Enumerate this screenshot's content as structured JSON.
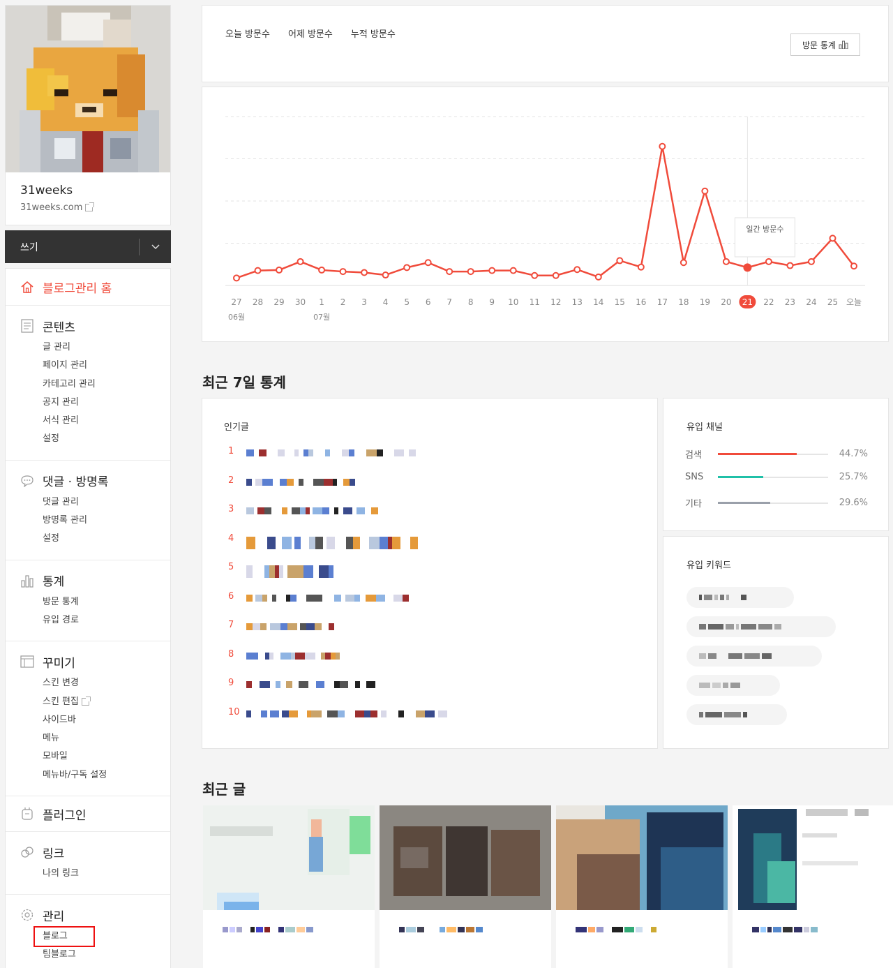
{
  "sidebar": {
    "blog_name": "31weeks",
    "blog_url": "31weeks.com",
    "write_label": "쓰기",
    "home_label": "블로그관리 홈",
    "groups": [
      {
        "title": "콘텐츠",
        "items": [
          "글 관리",
          "페이지 관리",
          "카테고리 관리",
          "공지 관리",
          "서식 관리",
          "설정"
        ]
      },
      {
        "title": "댓글 · 방명록",
        "items": [
          "댓글 관리",
          "방명록 관리",
          "설정"
        ]
      },
      {
        "title": "통계",
        "items": [
          "방문 통계",
          "유입 경로"
        ]
      },
      {
        "title": "꾸미기",
        "items": [
          "스킨 변경",
          "스킨 편집",
          "사이드바",
          "메뉴",
          "모바일",
          "메뉴바/구독 설정"
        ]
      },
      {
        "title": "플러그인",
        "items": []
      },
      {
        "title": "링크",
        "items": [
          "나의 링크"
        ]
      },
      {
        "title": "관리",
        "items": [
          "블로그",
          "팀블로그"
        ]
      }
    ]
  },
  "visits": {
    "tabs": [
      "오늘 방문수",
      "어제 방문수",
      "누적 방문수"
    ],
    "stat_button": "방문 통계"
  },
  "chart_data": {
    "type": "line",
    "x": [
      "27",
      "28",
      "29",
      "30",
      "1",
      "2",
      "3",
      "4",
      "5",
      "6",
      "7",
      "8",
      "9",
      "10",
      "11",
      "12",
      "13",
      "14",
      "15",
      "16",
      "17",
      "18",
      "19",
      "20",
      "21",
      "22",
      "23",
      "24",
      "25",
      "오늘"
    ],
    "month_labels": [
      "06월",
      "07월"
    ],
    "highlight_index": 24,
    "tooltip": "일간 방문수",
    "values": [
      15,
      30,
      31,
      48,
      31,
      28,
      26,
      21,
      36,
      46,
      28,
      28,
      30,
      30,
      20,
      20,
      32,
      17,
      50,
      37,
      280,
      46,
      190,
      48,
      36,
      48,
      40,
      48,
      95,
      39
    ],
    "ylim": [
      0,
      340
    ],
    "grid": true,
    "line_color": "#f04b3b"
  },
  "recent7": {
    "title": "최근 7일 통계",
    "popular_title": "인기글",
    "popular_ranks": [
      "1",
      "2",
      "3",
      "4",
      "5",
      "6",
      "7",
      "8",
      "9",
      "10"
    ],
    "channel_title": "유입 채널",
    "channels": [
      {
        "name": "검색",
        "pct": "44.7%",
        "value": 0.447,
        "color": "#f04b3b"
      },
      {
        "name": "SNS",
        "pct": "25.7%",
        "value": 0.257,
        "color": "#20c0a8"
      },
      {
        "name": "기타",
        "pct": "29.6%",
        "value": 0.296,
        "color": "#9aa0aa"
      }
    ],
    "keyword_title": "유입 키워드"
  },
  "recent_posts": {
    "title": "최근 글"
  }
}
